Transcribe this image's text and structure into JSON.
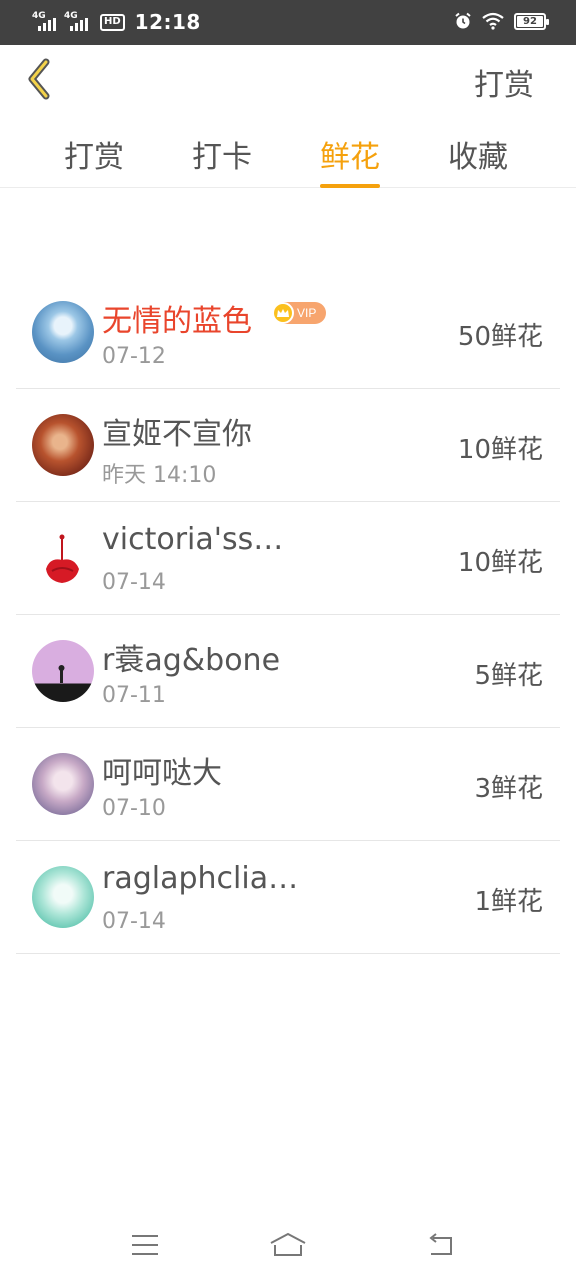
{
  "status_bar": {
    "network1": "4G",
    "network2": "4G",
    "hd": "HD",
    "time": "12:18",
    "battery": "92"
  },
  "header": {
    "action_label": "打赏"
  },
  "tabs": [
    {
      "label": "打赏",
      "active": false
    },
    {
      "label": "打卡",
      "active": false
    },
    {
      "label": "鲜花",
      "active": true
    },
    {
      "label": "收藏",
      "active": false
    }
  ],
  "list": [
    {
      "name": "无情的蓝色",
      "date": "07-12",
      "amount": "50鲜花",
      "vip": true,
      "vip_label": "VIP"
    },
    {
      "name": "宣姬不宣你",
      "date": "昨天 14:10",
      "amount": "10鲜花",
      "vip": false
    },
    {
      "name": "victoria'ss…",
      "date": "07-14",
      "amount": "10鲜花",
      "vip": false
    },
    {
      "name": "r蓑ag&bone",
      "date": "07-11",
      "amount": "5鲜花",
      "vip": false
    },
    {
      "name": "呵呵哒大",
      "date": "07-10",
      "amount": "3鲜花",
      "vip": false
    },
    {
      "name": "raglaphclia…",
      "date": "07-14",
      "amount": "1鲜花",
      "vip": false
    }
  ],
  "colors": {
    "accent": "#f5a10d",
    "vip_name": "#e9452c",
    "status_bar_bg": "#414141"
  },
  "icons": {
    "back": "chevron-left-icon",
    "menu": "menu-icon",
    "home": "home-icon",
    "return": "return-icon"
  }
}
